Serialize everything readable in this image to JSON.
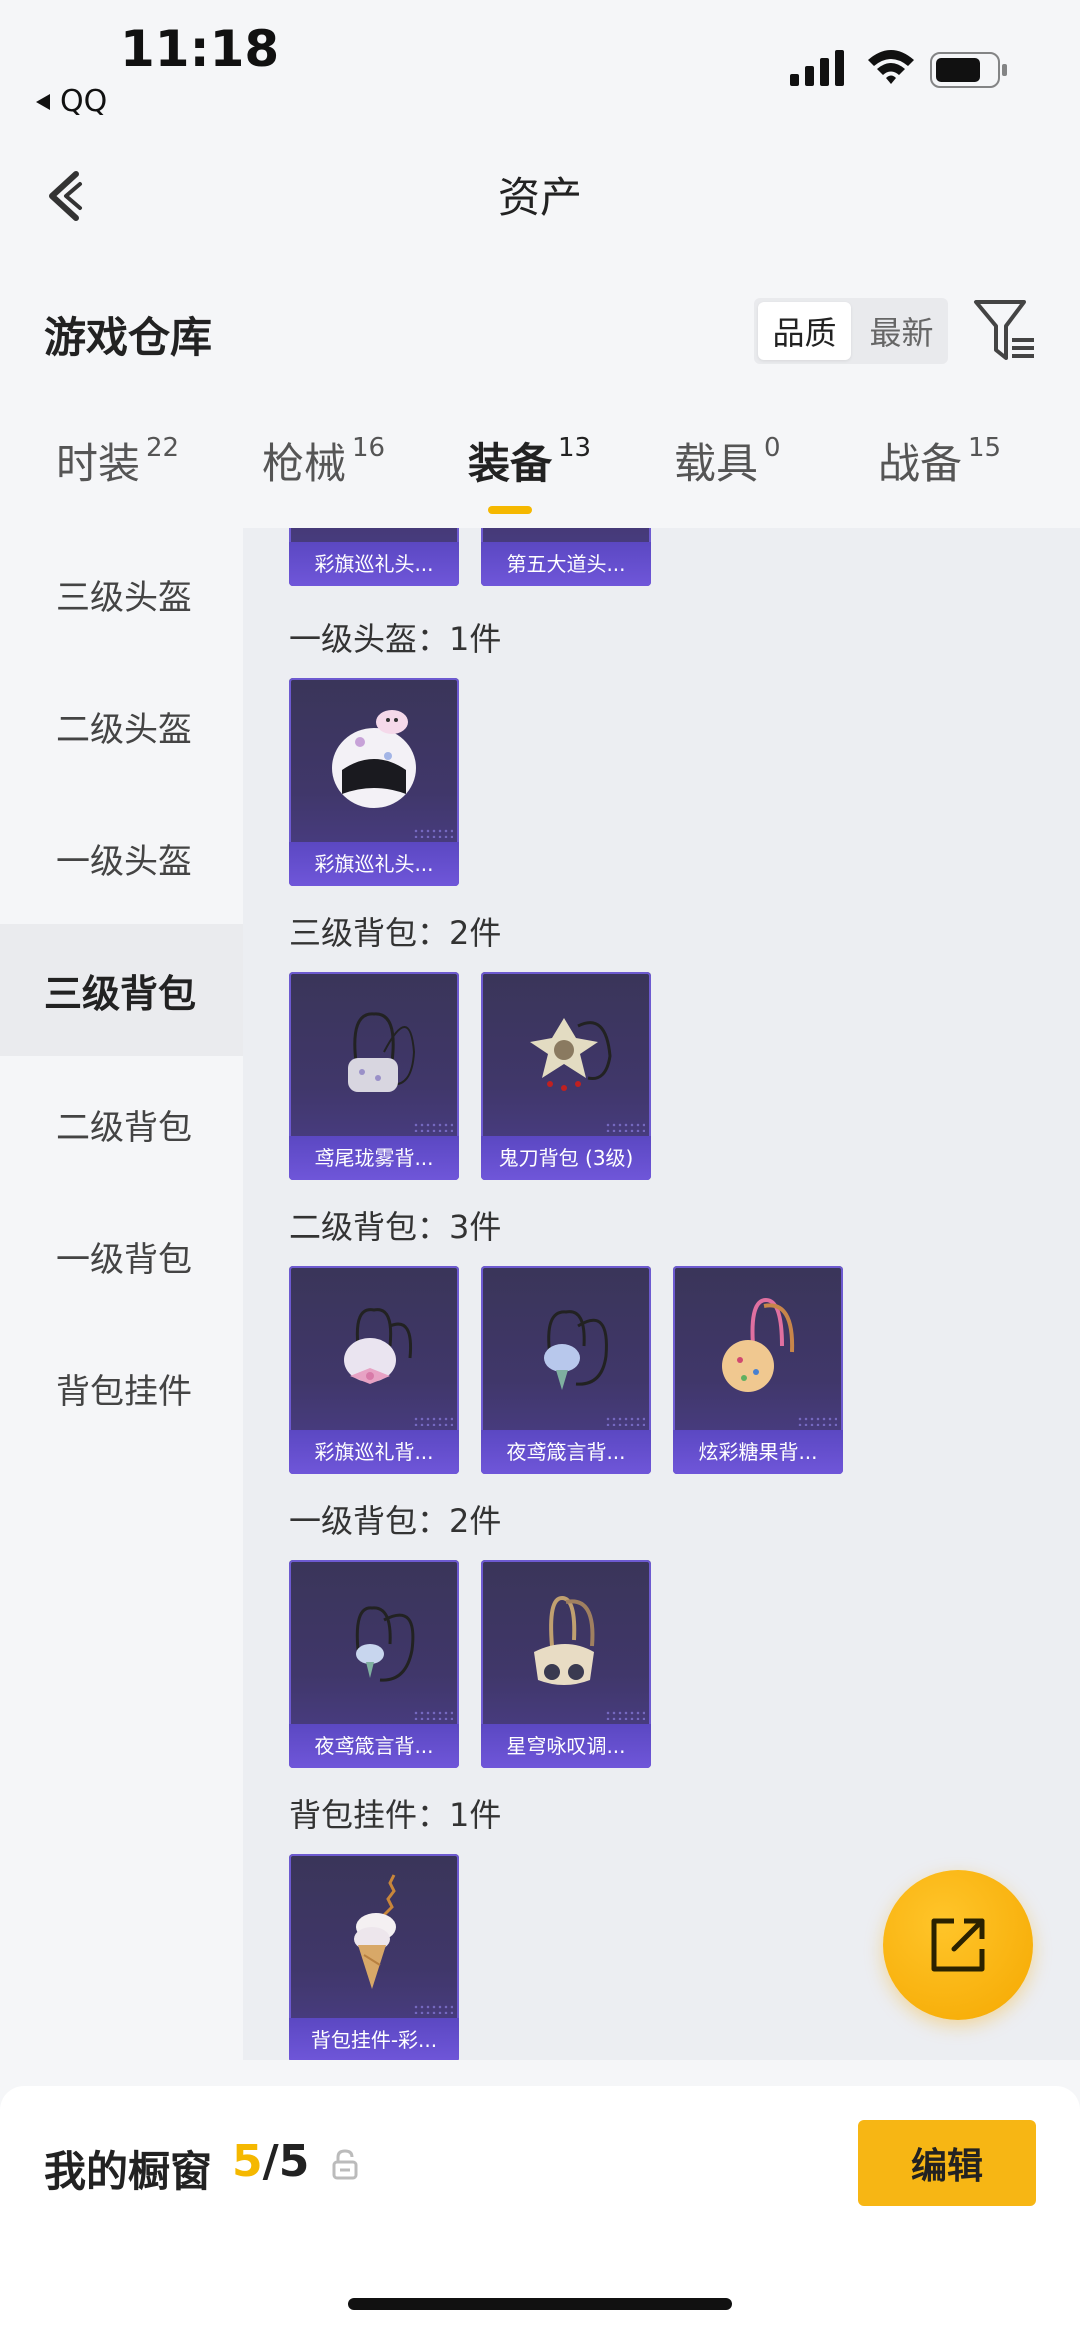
{
  "status_bar": {
    "time": "11:18",
    "back_app": "QQ"
  },
  "header": {
    "title": "资产"
  },
  "warehouse": {
    "label": "游戏仓库",
    "sort_options": [
      "品质",
      "最新"
    ],
    "active_sort": "品质"
  },
  "tabs": [
    {
      "label": "时装",
      "count": "22"
    },
    {
      "label": "枪械",
      "count": "16"
    },
    {
      "label": "装备",
      "count": "13",
      "active": true
    },
    {
      "label": "载具",
      "count": "0"
    },
    {
      "label": "战备",
      "count": "15"
    }
  ],
  "sidebar": [
    "三级头盔",
    "二级头盔",
    "一级头盔",
    "三级背包",
    "二级背包",
    "一级背包",
    "背包挂件"
  ],
  "sidebar_active": "三级背包",
  "sections": {
    "top_partial": {
      "items": [
        "彩旗巡礼头...",
        "第五大道头..."
      ]
    },
    "helmet1": {
      "title": "一级头盔：1件",
      "items": [
        "彩旗巡礼头..."
      ]
    },
    "bag3": {
      "title": "三级背包：2件",
      "items": [
        "鸢尾珑雾背...",
        "鬼刀背包 (3级)"
      ]
    },
    "bag2": {
      "title": "二级背包：3件",
      "items": [
        "彩旗巡礼背...",
        "夜鸢箴言背...",
        "炫彩糖果背..."
      ]
    },
    "bag1": {
      "title": "一级背包：2件",
      "items": [
        "夜鸢箴言背...",
        "星穹咏叹调..."
      ]
    },
    "pendant": {
      "title": "背包挂件：1件",
      "items": [
        "背包挂件-彩..."
      ]
    }
  },
  "bottom": {
    "label": "我的橱窗",
    "count_current": "5",
    "count_total": "/5",
    "edit_label": "编辑"
  },
  "colors": {
    "accent": "#f5b800",
    "card_purple": "#4d3f8e"
  }
}
